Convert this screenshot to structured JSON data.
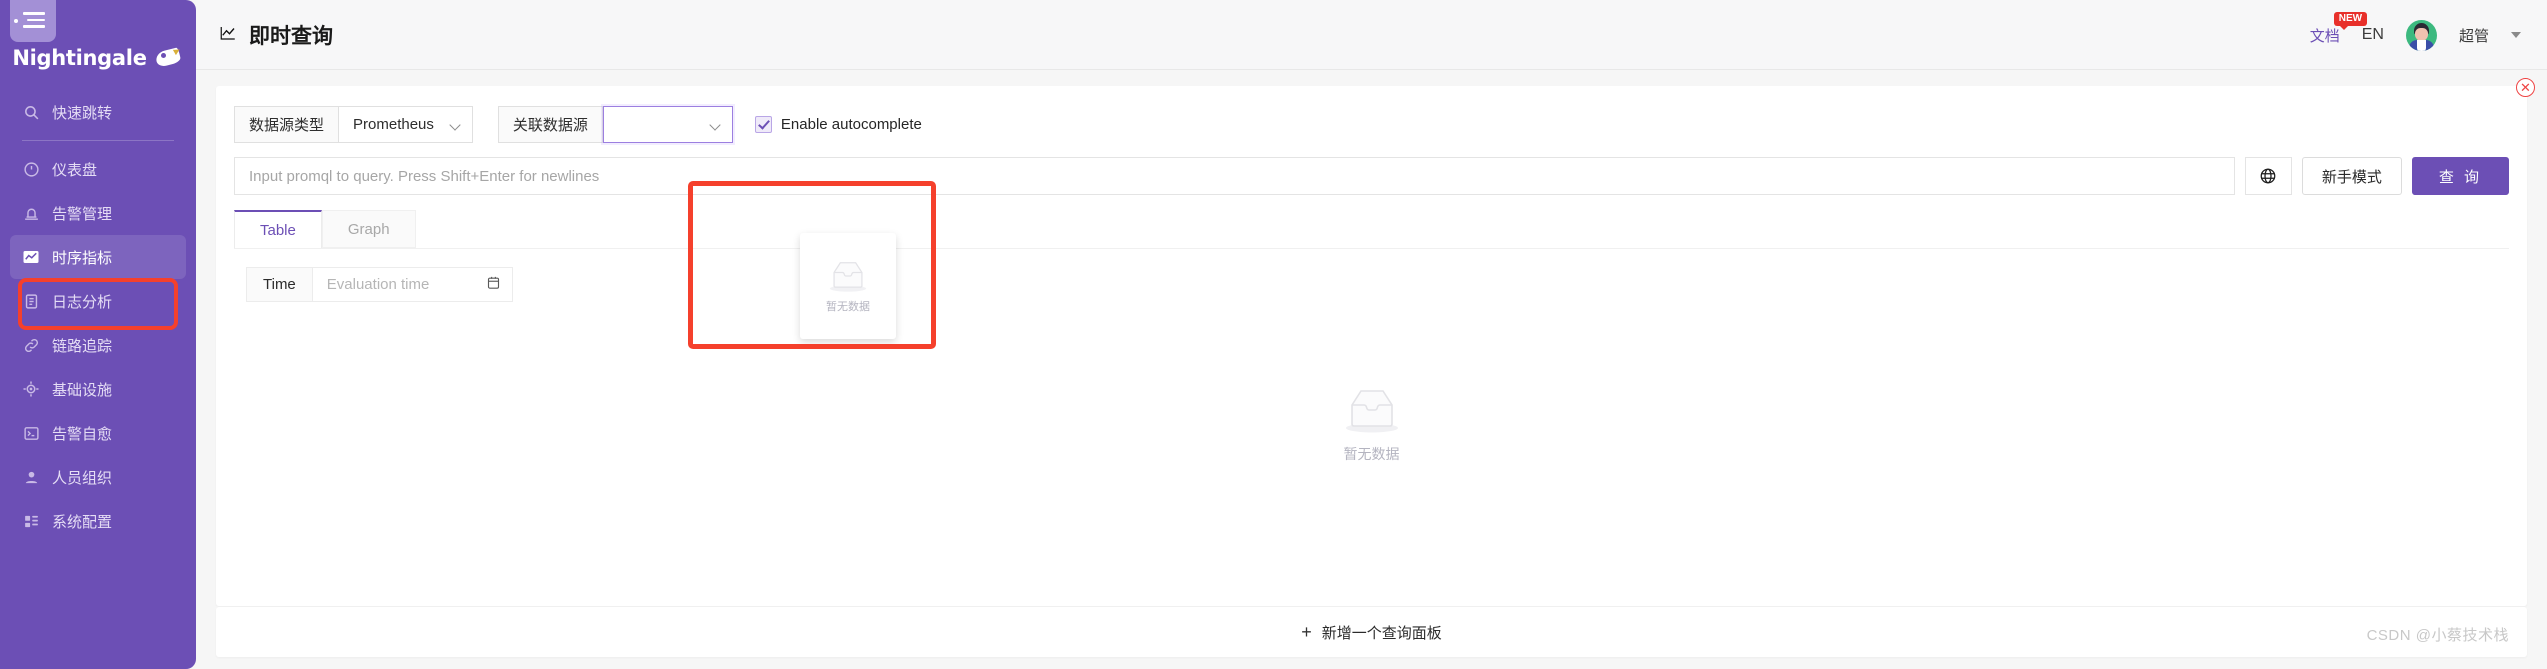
{
  "brand": {
    "name": "Nightingale",
    "logo_icon": "bird-logo-icon"
  },
  "sidebar": {
    "collapse_icon": "collapse-sidebar-icon",
    "items": [
      {
        "id": "quick-jump",
        "label": "快速跳转",
        "icon": "search-icon"
      },
      {
        "id": "dashboard",
        "label": "仪表盘",
        "icon": "gauge-icon"
      },
      {
        "id": "alert-manage",
        "label": "告警管理",
        "icon": "bell-icon"
      },
      {
        "id": "metrics",
        "label": "时序指标",
        "icon": "line-chart-icon"
      },
      {
        "id": "log-analysis",
        "label": "日志分析",
        "icon": "document-icon"
      },
      {
        "id": "tracing",
        "label": "链路追踪",
        "icon": "link-icon"
      },
      {
        "id": "infrastructure",
        "label": "基础设施",
        "icon": "target-icon"
      },
      {
        "id": "alert-selfheal",
        "label": "告警自愈",
        "icon": "terminal-icon"
      },
      {
        "id": "org-members",
        "label": "人员组织",
        "icon": "user-icon"
      },
      {
        "id": "system-config",
        "label": "系统配置",
        "icon": "grid-icon"
      }
    ],
    "active_id": "metrics",
    "accent": "#6c4fb5"
  },
  "header": {
    "title": "即时查询",
    "title_icon": "line-chart-icon",
    "doc_label": "文档",
    "doc_badge": "NEW",
    "lang_label": "EN",
    "user_name": "超管",
    "user_caret_icon": "chevron-down-icon",
    "avatar_icon": "user-avatar"
  },
  "panel": {
    "close_icon": "close-circle-icon",
    "datasource_type": {
      "addon_label": "数据源类型",
      "value": "Prometheus",
      "caret_icon": "chevron-down-icon"
    },
    "related_datasource": {
      "addon_label": "关联数据源",
      "value": "",
      "caret_icon": "chevron-down-icon",
      "dropdown": {
        "empty_label": "暂无数据",
        "empty_icon": "empty-box-icon"
      }
    },
    "autocomplete": {
      "label": "Enable autocomplete",
      "checked": true,
      "check_icon": "checkmark-icon"
    },
    "query_input": {
      "placeholder": "Input promql to query. Press Shift+Enter for newlines",
      "value": ""
    },
    "globe_button": {
      "icon": "globe-icon"
    },
    "beginner_mode_button": {
      "label": "新手模式"
    },
    "query_button": {
      "label": "查 询",
      "color": "#6c4fb5"
    },
    "tabs": [
      {
        "id": "table",
        "label": "Table",
        "active": true
      },
      {
        "id": "graph",
        "label": "Graph",
        "active": false
      }
    ],
    "time_field": {
      "addon_label": "Time",
      "placeholder": "Evaluation time",
      "value": "",
      "calendar_icon": "calendar-icon"
    },
    "result_empty": {
      "label": "暂无数据",
      "icon": "empty-box-icon"
    }
  },
  "footer": {
    "add_panel_label": "新增一个查询面板",
    "add_panel_icon": "plus-icon"
  },
  "watermark": {
    "text": "CSDN @小蔡技术栈"
  },
  "annotations": {
    "highlight_color": "#f5402c"
  }
}
